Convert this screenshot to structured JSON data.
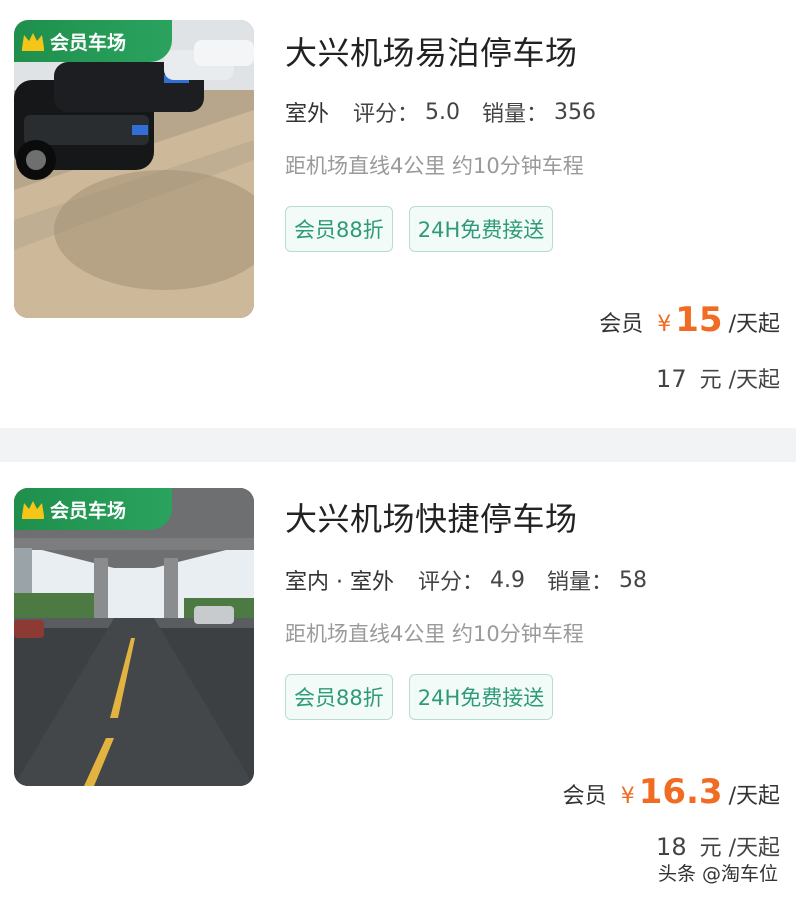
{
  "listings": [
    {
      "badge": "会员车场",
      "name": "大兴机场易泊停车场",
      "environment": "室外",
      "rating_label": "评分：",
      "rating": "5.0",
      "sales_label": "销量：",
      "sales": "356",
      "distance": "距机场直线4公里 约10分钟车程",
      "tags": [
        "会员88折",
        "24H免费接送"
      ],
      "member_label": "会员",
      "currency": "¥",
      "member_price": "15",
      "price_unit": "/天起",
      "original_price": "17",
      "original_unit": "元 /天起"
    },
    {
      "badge": "会员车场",
      "name": "大兴机场快捷停车场",
      "environment": "室内 · 室外",
      "rating_label": "评分：",
      "rating": "4.9",
      "sales_label": "销量：",
      "sales": "58",
      "distance": "距机场直线4公里 约10分钟车程",
      "tags": [
        "会员88折",
        "24H免费接送"
      ],
      "member_label": "会员",
      "currency": "¥",
      "member_price": "16.3",
      "price_unit": "/天起",
      "original_price": "18",
      "original_unit": "元 /天起"
    }
  ],
  "watermark": "头条 @淘车位",
  "colors": {
    "accent_price": "#f26b22",
    "member_badge": "#1f8f4c",
    "tag_text": "#2d9a78"
  }
}
